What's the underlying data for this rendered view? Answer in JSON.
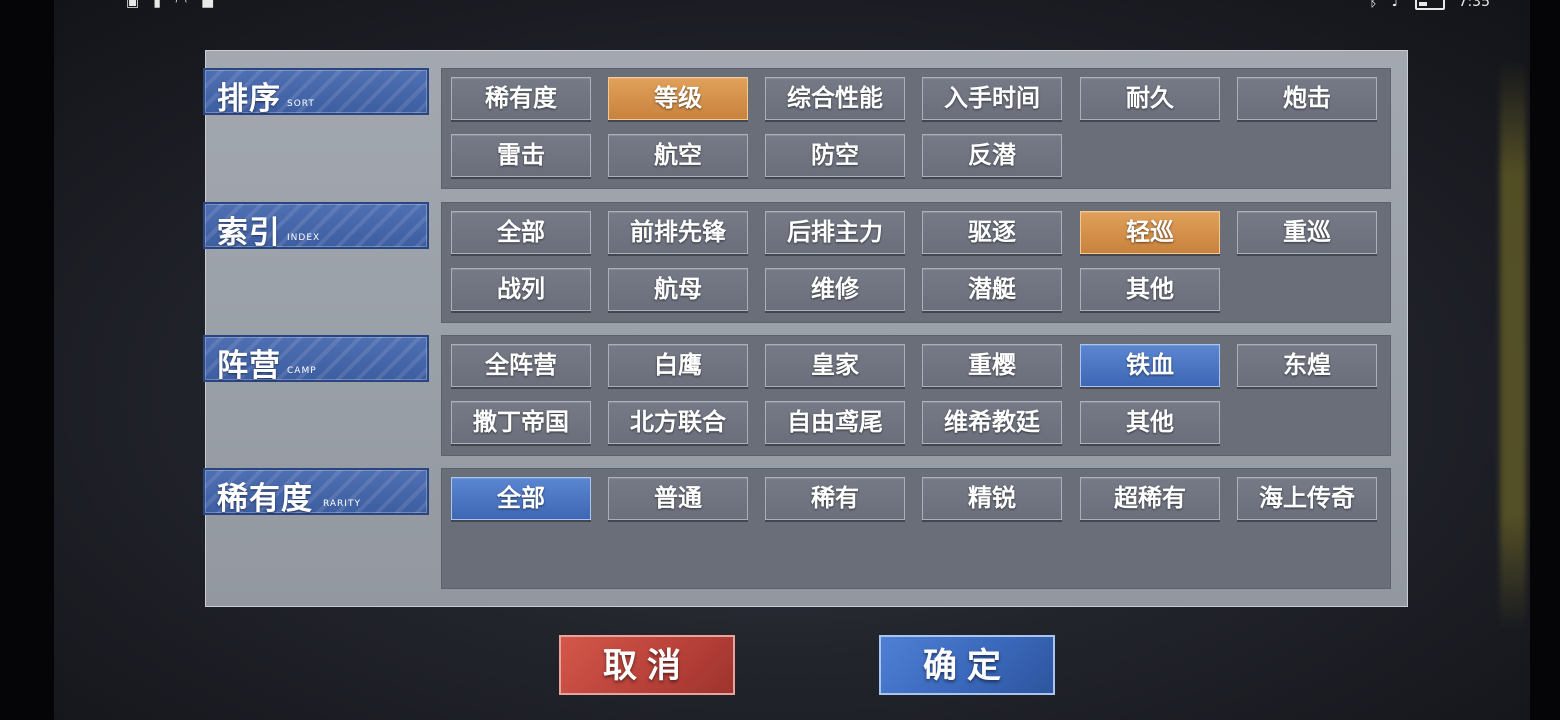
{
  "status_bar": {
    "left_icons": [
      "HD",
      "signal",
      "wifi",
      "notification"
    ],
    "right_time": "7:35"
  },
  "sort": {
    "title": "排序",
    "subtitle": "SORT",
    "options": [
      "稀有度",
      "等级",
      "综合性能",
      "入手时间",
      "耐久",
      "炮击",
      "雷击",
      "航空",
      "防空",
      "反潜"
    ],
    "selected": "等级"
  },
  "index": {
    "title": "索引",
    "subtitle": "INDEX",
    "options": [
      "全部",
      "前排先锋",
      "后排主力",
      "驱逐",
      "轻巡",
      "重巡",
      "战列",
      "航母",
      "维修",
      "潜艇",
      "其他"
    ],
    "selected": "轻巡"
  },
  "camp": {
    "title": "阵营",
    "subtitle": "CAMP",
    "options": [
      "全阵营",
      "白鹰",
      "皇家",
      "重樱",
      "铁血",
      "东煌",
      "撒丁帝国",
      "北方联合",
      "自由鸢尾",
      "维希教廷",
      "其他"
    ],
    "selected": "铁血"
  },
  "rarity": {
    "title": "稀有度",
    "subtitle": "RARITY",
    "options": [
      "全部",
      "普通",
      "稀有",
      "精锐",
      "超稀有",
      "海上传奇"
    ],
    "selected": "全部"
  },
  "buttons": {
    "cancel": "取消",
    "confirm": "确定"
  },
  "colors": {
    "selected_orange": "#d9934c",
    "selected_blue": "#4a75c4",
    "cancel_red": "#c24a40",
    "confirm_blue": "#3d6bbd"
  }
}
